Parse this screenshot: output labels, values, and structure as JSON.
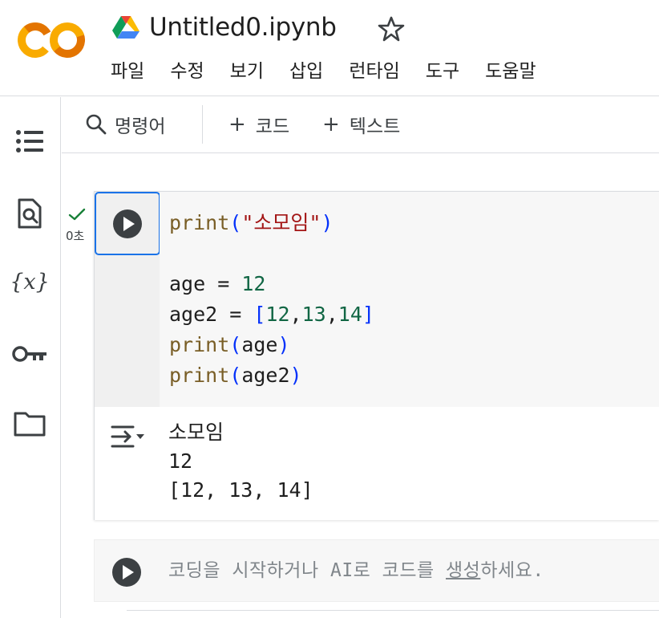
{
  "header": {
    "doc_title": "Untitled0.ipynb",
    "menu": [
      "파일",
      "수정",
      "보기",
      "삽입",
      "런타임",
      "도구",
      "도움말"
    ]
  },
  "colors": {
    "accent": "#1a73e8",
    "logo_orange": "#f9ab00",
    "logo_dark_orange": "#e37400",
    "check_green": "#188038"
  },
  "rail": {
    "icons": [
      "toc-icon",
      "find-replace-icon",
      "variables-icon",
      "key-icon",
      "folder-icon"
    ],
    "variables_label": "{x}"
  },
  "toolbar": {
    "search_label": "명령어",
    "add_code_label": "코드",
    "add_text_label": "텍스트",
    "plus": "+"
  },
  "cell": {
    "exec_time": "0초",
    "code_lines": [
      [
        {
          "t": "print",
          "c": "fn"
        },
        {
          "t": "(",
          "c": "par"
        },
        {
          "t": "\"소모임\"",
          "c": "str"
        },
        {
          "t": ")",
          "c": "par"
        }
      ],
      [],
      [
        {
          "t": "age = ",
          "c": "op"
        },
        {
          "t": "12",
          "c": "num"
        }
      ],
      [
        {
          "t": "age2 = ",
          "c": "op"
        },
        {
          "t": "[",
          "c": "par"
        },
        {
          "t": "12",
          "c": "num"
        },
        {
          "t": ",",
          "c": "op"
        },
        {
          "t": "13",
          "c": "num"
        },
        {
          "t": ",",
          "c": "op"
        },
        {
          "t": "14",
          "c": "num"
        },
        {
          "t": "]",
          "c": "par"
        }
      ],
      [
        {
          "t": "print",
          "c": "fn"
        },
        {
          "t": "(",
          "c": "par"
        },
        {
          "t": "age",
          "c": "op"
        },
        {
          "t": ")",
          "c": "par"
        }
      ],
      [
        {
          "t": "print",
          "c": "fn"
        },
        {
          "t": "(",
          "c": "par"
        },
        {
          "t": "age2",
          "c": "op"
        },
        {
          "t": ")",
          "c": "par"
        }
      ]
    ],
    "output_lines": [
      "소모임",
      "12",
      "[12, 13, 14]"
    ]
  },
  "empty_cell": {
    "placeholder_before": "코딩을 시작하거나 AI로 코드를 ",
    "placeholder_link": "생성",
    "placeholder_after": "하세요."
  }
}
